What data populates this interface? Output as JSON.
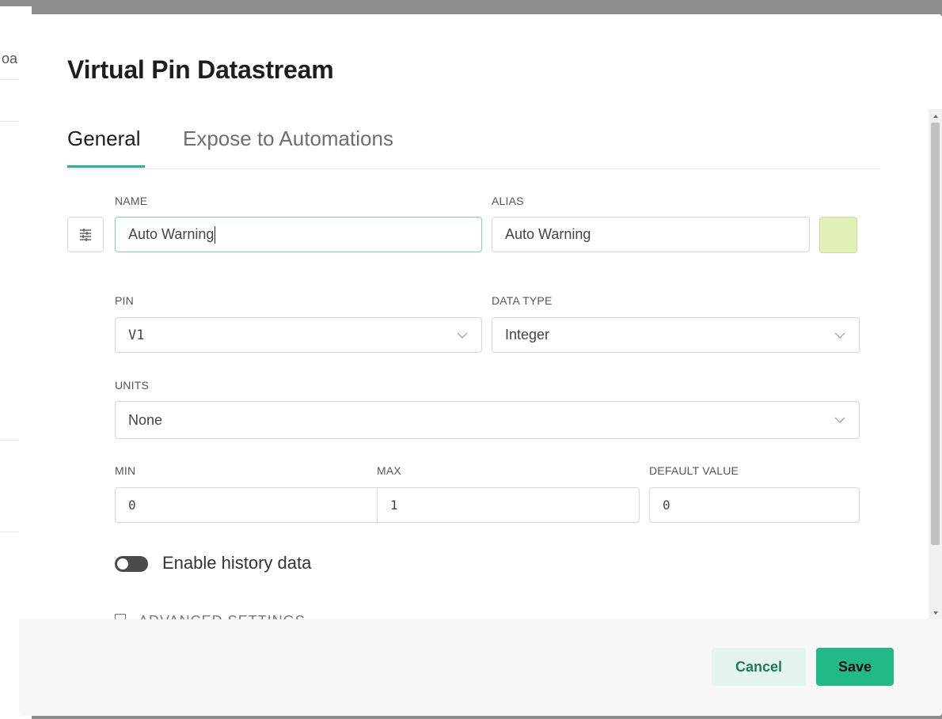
{
  "backdrop": {
    "partial_text": "oa"
  },
  "modal": {
    "title": "Virtual Pin Datastream",
    "tabs": [
      {
        "label": "General",
        "active": true
      },
      {
        "label": "Expose to Automations",
        "active": false
      }
    ]
  },
  "form": {
    "name": {
      "label": "NAME",
      "value": "Auto Warning"
    },
    "alias": {
      "label": "ALIAS",
      "value": "Auto Warning"
    },
    "color_swatch": "#e1f0b4",
    "pin": {
      "label": "PIN",
      "value": "V1"
    },
    "data_type": {
      "label": "DATA TYPE",
      "value": "Integer"
    },
    "units": {
      "label": "UNITS",
      "value": "None"
    },
    "min": {
      "label": "MIN",
      "value": "0"
    },
    "max": {
      "label": "MAX",
      "value": "1"
    },
    "default_value": {
      "label": "DEFAULT VALUE",
      "value": "0"
    },
    "history": {
      "label": "Enable history data",
      "enabled": false
    },
    "advanced": {
      "label": "ADVANCED SETTINGS"
    }
  },
  "footer": {
    "cancel_label": "Cancel",
    "save_label": "Save"
  },
  "colors": {
    "accent": "#22b988",
    "cancel_bg": "#e3f5ee"
  }
}
